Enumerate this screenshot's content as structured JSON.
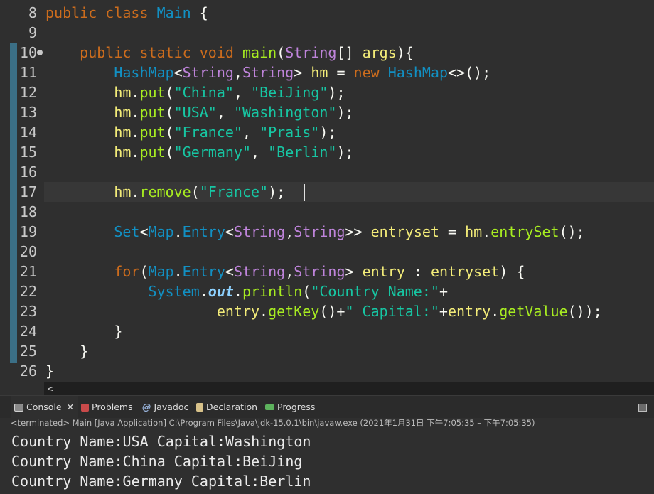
{
  "editor": {
    "line_numbers": [
      "8",
      "9",
      "10",
      "11",
      "12",
      "13",
      "14",
      "15",
      "16",
      "17",
      "18",
      "19",
      "20",
      "21",
      "22",
      "23",
      "24",
      "25",
      "26"
    ],
    "lines": [
      "public class Main {",
      "",
      "    public static void main(String[] args){",
      "        HashMap<String,String> hm = new HashMap<>();",
      "        hm.put(\"China\", \"BeiJing\");",
      "        hm.put(\"USA\", \"Washington\");",
      "        hm.put(\"France\", \"Prais\");",
      "        hm.put(\"Germany\", \"Berlin\");",
      "",
      "        hm.remove(\"France\");",
      "",
      "        Set<Map.Entry<String,String>> entryset = hm.entrySet();",
      "",
      "        for(Map.Entry<String,String> entry : entryset) {",
      "            System.out.println(\"Country Name:\"+",
      "                    entry.getKey()+\" Capital:\"+entry.getValue());",
      "        }",
      "    }",
      "}"
    ],
    "scroll_left_glyph": "<"
  },
  "console": {
    "tabs": [
      {
        "label": "Console",
        "icon": "console-icon",
        "close": "✕"
      },
      {
        "label": "Problems",
        "icon": "problems-icon"
      },
      {
        "label": "Javadoc",
        "icon": "javadoc-icon",
        "glyph": "@"
      },
      {
        "label": "Declaration",
        "icon": "declaration-icon"
      },
      {
        "label": "Progress",
        "icon": "progress-icon"
      }
    ],
    "status": "<terminated> Main [Java Application] C:\\Program Files\\Java\\jdk-15.0.1\\bin\\javaw.exe  (2021年1月31日 下午7:05:35 – 下午7:05:35)",
    "output": [
      "Country Name:USA Capital:Washington",
      "Country Name:China Capital:BeiJing",
      "Country Name:Germany Capital:Berlin"
    ]
  },
  "colors": {
    "background": "#2f2f2f",
    "keyword": "#cc6c1d",
    "type": "#1290c3",
    "generic": "#bf84db",
    "variable": "#f3ec79",
    "field": "#66e1f8",
    "method": "#a7ec21",
    "string": "#17c6a3"
  }
}
